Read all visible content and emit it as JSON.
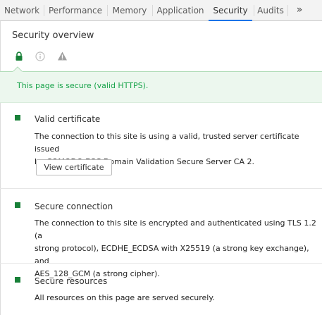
{
  "tabs": [
    {
      "label": "Network",
      "active": false
    },
    {
      "label": "Performance",
      "active": false
    },
    {
      "label": "Memory",
      "active": false
    },
    {
      "label": "Application",
      "active": false
    },
    {
      "label": "Security",
      "active": true
    },
    {
      "label": "Audits",
      "active": false
    }
  ],
  "overflow_label": "»",
  "page_title": "Security overview",
  "summary_icons": [
    "lock-icon",
    "info-icon",
    "warning-icon"
  ],
  "banner": {
    "text": "This page is secure (valid HTTPS).",
    "color": "#18a34a"
  },
  "sections": {
    "certificate": {
      "title": "Valid certificate",
      "line1": "The connection to this site is using a valid, trusted server certificate issued",
      "line2": "by COMODO ECC Domain Validation Secure Server CA 2.",
      "button_label": "View certificate"
    },
    "connection": {
      "title": "Secure connection",
      "line1": "The connection to this site is encrypted and authenticated using TLS 1.2 (a",
      "line2": "strong protocol), ECDHE_ECDSA with X25519 (a strong key exchange), and",
      "line3": "AES_128_GCM (a strong cipher)."
    },
    "resources": {
      "title": "Secure resources",
      "line1": "All resources on this page are served securely."
    }
  },
  "colors": {
    "secure_green": "#188038",
    "active_tab_underline": "#1a73e8"
  }
}
